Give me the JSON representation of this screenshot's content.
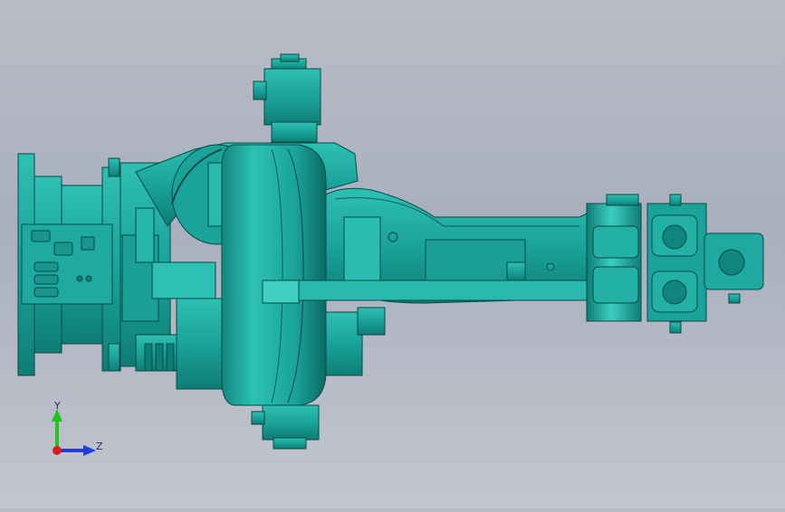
{
  "viewport": {
    "model_color": "#1aa39a",
    "model_edge_color": "#064a45",
    "model_highlight": "#3fd0c3",
    "model_shadow": "#0c6f68"
  },
  "triad": {
    "y_label": "Y",
    "z_label": "Z",
    "y_color": "#22c322",
    "z_color": "#1f3fd6",
    "x_color": "#d62020"
  }
}
